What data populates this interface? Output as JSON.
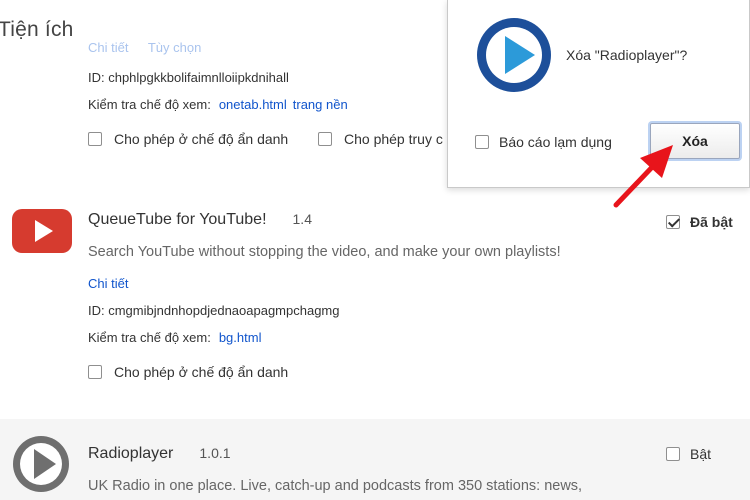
{
  "page": {
    "title": "Tiện ích"
  },
  "extension_onetab": {
    "partial_links": [
      "Chi tiết",
      "Tùy chọn"
    ],
    "id_text": "ID: chphlpgkkbolifaimnlloiipkdnihall",
    "inspect_label": "Kiểm tra chế độ xem:",
    "inspect_links": [
      "onetab.html",
      "trang nền"
    ],
    "allow_incognito": "Cho phép ở chế độ ẩn danh",
    "allow_file_access": "Cho phép truy c"
  },
  "extension_queuetube": {
    "name": "QueueTube for YouTube!",
    "version": "1.4",
    "enabled_label": "Đã bật",
    "enabled": true,
    "description": "Search YouTube without stopping the video, and make your own playlists!",
    "details_link": "Chi tiết",
    "id_text": "ID: cmgmibjndnhopdjednaoapagmpchagmg",
    "inspect_label": "Kiểm tra chế độ xem:",
    "inspect_link": "bg.html",
    "allow_incognito": "Cho phép ở chế độ ẩn danh"
  },
  "extension_radioplayer": {
    "name": "Radioplayer",
    "version": "1.0.1",
    "enable_label": "Bật",
    "enabled": false,
    "description": "UK Radio in one place. Live, catch-up and podcasts from 350 stations: news,"
  },
  "dialog": {
    "message": "Xóa \"Radioplayer\"?",
    "report_abuse": "Báo cáo lạm dụng",
    "remove_button": "Xóa"
  },
  "colors": {
    "link": "#1155cc",
    "youtube_red": "#d63b2f",
    "radioplayer_blue": "#1d4f9a",
    "annotation_arrow": "#e8141b"
  }
}
